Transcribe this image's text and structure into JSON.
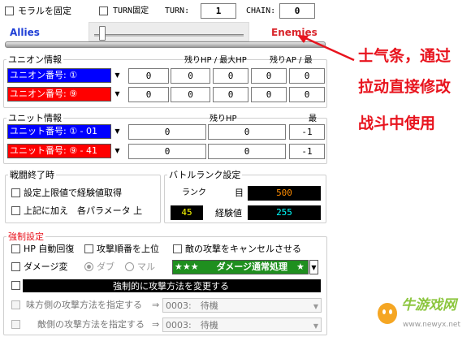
{
  "top": {
    "morale_lock_label": "モラルを固定",
    "turn_lock_label": "TURN固定",
    "turn_label": "TURN:",
    "turn_value": "1",
    "chain_label": "CHAIN:",
    "chain_value": "0"
  },
  "morale": {
    "allies_label": "Allies",
    "enemies_label": "Enemies",
    "allies_color": "#1f3fd6",
    "enemies_color": "#d9252b",
    "slider_level": 0.03
  },
  "annotation": {
    "line1": "士气条，通过",
    "line2": "拉动直接修改",
    "line3": "战斗中使用",
    "color": "#e8141e"
  },
  "union": {
    "title": "ユニオン情報",
    "headers": [
      "残りHP / 最大HP",
      "残りAP / 最"
    ],
    "rows": [
      {
        "select": "ユニオン番号: ①",
        "color": "#0000ff",
        "values": [
          "0",
          "0",
          "0",
          "0",
          "0"
        ]
      },
      {
        "select": "ユニオン番号: ⑨",
        "color": "#ff0000",
        "values": [
          "0",
          "0",
          "0",
          "0",
          "0"
        ]
      }
    ]
  },
  "unit": {
    "title": "ユニット情報",
    "headers": [
      "残りHP",
      "最"
    ],
    "rows": [
      {
        "select": "ユニット番号: ① - 01",
        "color": "#0000ff",
        "values": [
          "0",
          "0",
          "-1"
        ]
      },
      {
        "select": "ユニット番号: ⑨ - 41",
        "color": "#ff0000",
        "values": [
          "0",
          "0",
          "-1"
        ]
      }
    ]
  },
  "battle_end": {
    "title": "戦闘終了時",
    "opt1": "設定上限値で経験値取得",
    "opt2": "上記に加え　各パラメータ 上"
  },
  "rank": {
    "title": "バトルランク設定",
    "rank_label": "ランク",
    "eye_label": "目",
    "value_orange": "500",
    "value_yellow": "45",
    "exp_label": "経験値",
    "value_cyan": "255"
  },
  "forced": {
    "title": "強制設定",
    "hp_regen": "HP 自動回復",
    "attack_order": "攻撃順番を上位",
    "cancel_enemy": "敵の攻撃をキャンセルさせる",
    "damage_change": "ダメージ変",
    "dub_label": "ダブ",
    "mal_label": "マル",
    "damage_combo": "★★★　　ダメージ通常処理　★",
    "force_attack": "強制的に攻撃方法を変更する",
    "ally_attack": "味方側の攻撃方法を指定する",
    "enemy_attack": "敵側の攻撃方法を指定する",
    "arrow": "⇒",
    "ally_combo": "0003:　待機",
    "enemy_combo": "0003:　待機"
  },
  "watermark": {
    "text": "牛游戏网",
    "url": "www.newyx.net"
  }
}
